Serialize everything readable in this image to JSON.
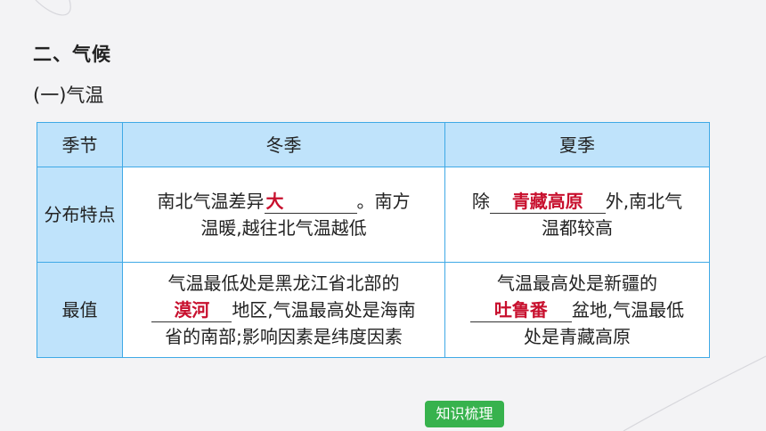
{
  "section_title": "二、气候",
  "sub_title": "(一)气温",
  "table": {
    "headers": [
      "季节",
      "冬季",
      "夏季"
    ],
    "distribution": {
      "label": "分布特点",
      "winter": {
        "pre": "南北气温差异",
        "answer": "大",
        "post1": "。南方",
        "post2": "温暖,越往北气温越低"
      },
      "summer": {
        "pre": "除",
        "answer": "青藏高原",
        "post1": "外,南北气",
        "post2": "温都较高"
      }
    },
    "extreme": {
      "label": "最值",
      "winter": {
        "line1": "气温最低处是黑龙江省北部的",
        "answer": "漠河",
        "post1": "地区,气温最高处是海南",
        "line3": "省的南部;影响因素是纬度因素"
      },
      "summer": {
        "line1": "气温最高处是新疆的",
        "answer": "吐鲁番",
        "post1": "盆地,气温最低",
        "line3": "处是青藏高原"
      }
    }
  },
  "footer_button": "知识梳理",
  "colors": {
    "header_bg": "#bfe3fb",
    "border": "#3fa9e6",
    "answer": "#c8102e",
    "button": "#37b24d"
  }
}
